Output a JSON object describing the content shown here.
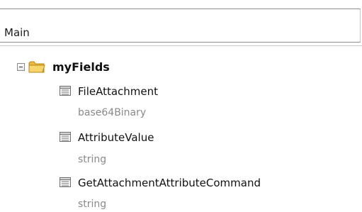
{
  "header": {
    "value": "Main"
  },
  "tree": {
    "root": {
      "label": "myFields",
      "expanded": true
    },
    "fields": [
      {
        "name": "FileAttachment",
        "type": "base64Binary"
      },
      {
        "name": "AttributeValue",
        "type": "string"
      },
      {
        "name": "GetAttachmentAttributeCommand",
        "type": "string"
      }
    ]
  },
  "icons": {
    "expander": "minus-box-icon",
    "root": "folder-icon",
    "field": "field-icon"
  },
  "colors": {
    "type_text": "#8a8a8a",
    "folder": "#f1c242"
  }
}
